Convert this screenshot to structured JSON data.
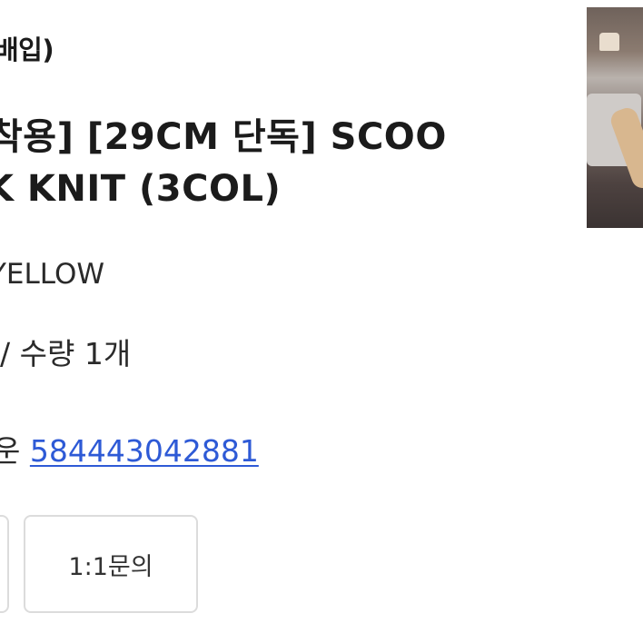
{
  "product": {
    "brand_partial": "배입)",
    "title_line1": "착용] [29CM 단독] SCOO",
    "title_line2": "K KNIT (3COL)",
    "option": "YELLOW",
    "quantity": "/ 수량 1개",
    "tracking_label_partial": "운",
    "tracking_number": "584443042881"
  },
  "buttons": {
    "inquiry_label": "1:1문의"
  },
  "thumbnail": {
    "icon": "product-photo"
  }
}
